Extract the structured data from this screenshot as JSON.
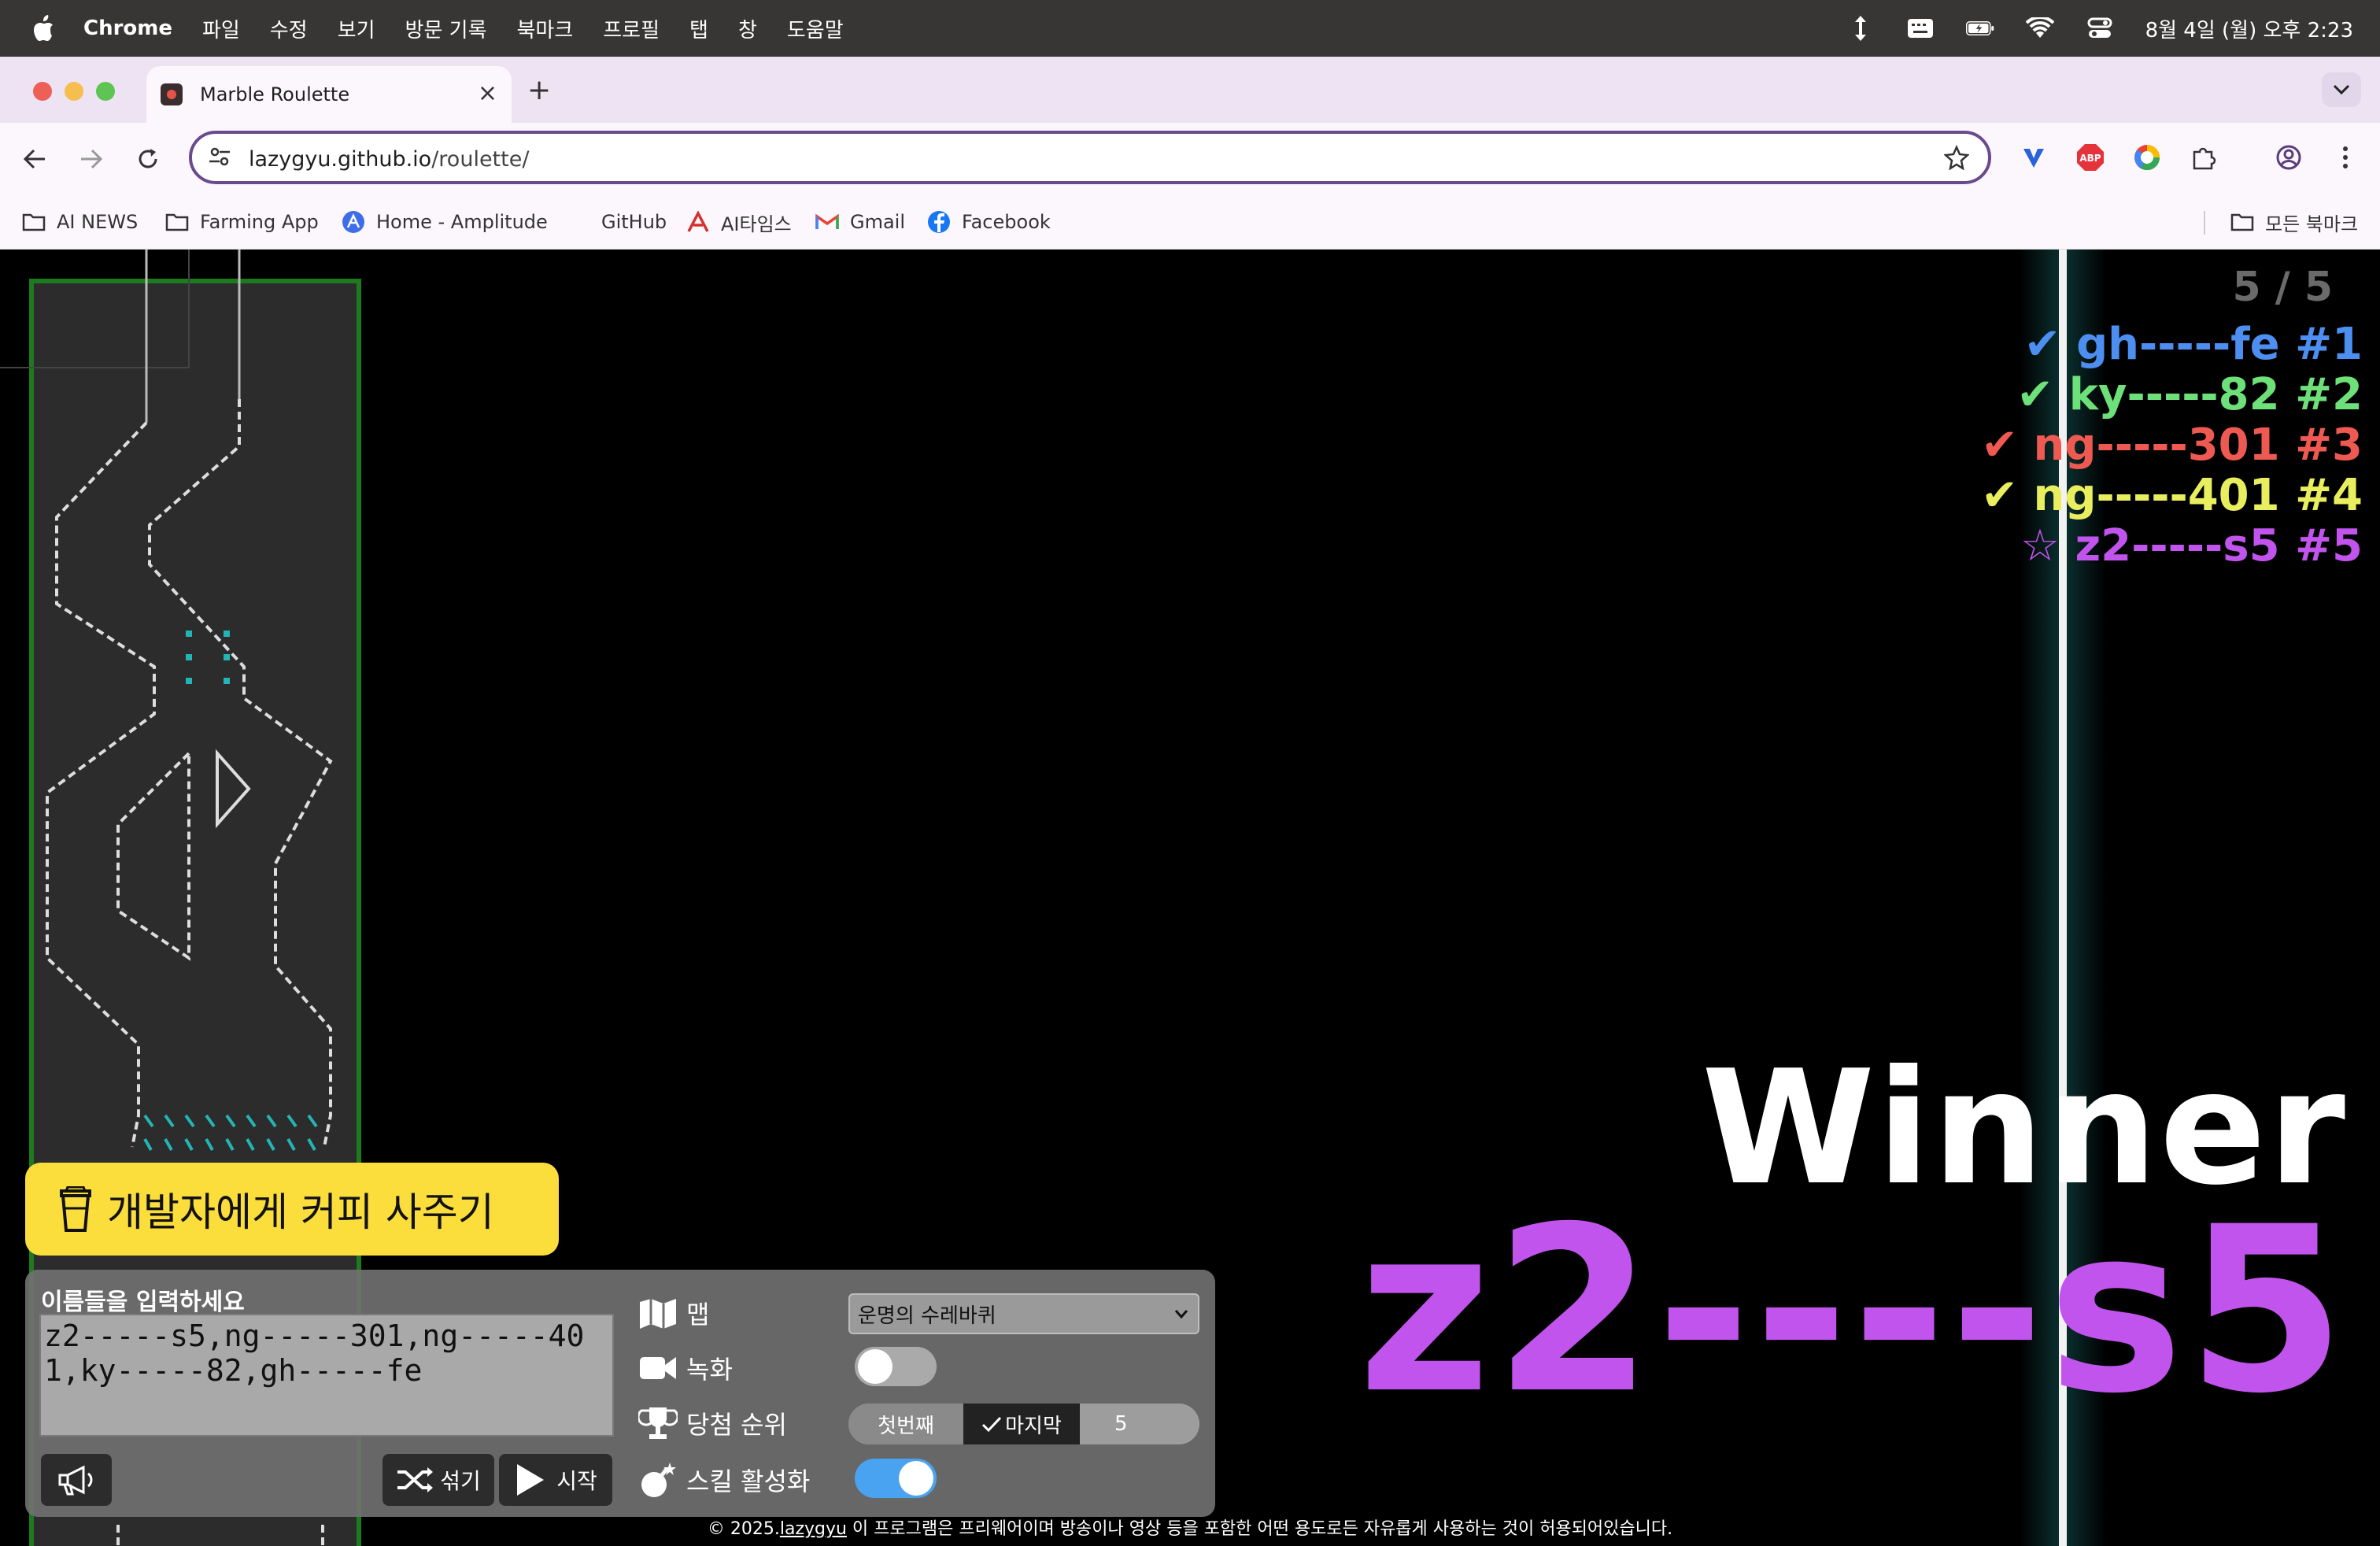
{
  "menubar": {
    "app": "Chrome",
    "items": [
      "파일",
      "수정",
      "보기",
      "방문 기록",
      "북마크",
      "프로필",
      "탭",
      "창",
      "도움말"
    ],
    "clock": "8월 4일 (월) 오후 2:23"
  },
  "tab": {
    "title": "Marble Roulette"
  },
  "address": {
    "host": "lazygyu.github.io",
    "path": "/roulette/"
  },
  "bookmarks": {
    "items": [
      "AI NEWS",
      "Farming App",
      "Home - Amplitude",
      "GitHub",
      "AI타임스",
      "Gmail",
      "Facebook"
    ],
    "all": "모든 북마크"
  },
  "game": {
    "progress": "5 / 5",
    "ranking": [
      {
        "mark": "✔",
        "name": "gh-----fe",
        "rank": "#1",
        "color": "#4d8ff0"
      },
      {
        "mark": "✔",
        "name": "ky-----82",
        "rank": "#2",
        "color": "#6ee07a"
      },
      {
        "mark": "✔",
        "name": "ng-----301",
        "rank": "#3",
        "color": "#ee5a52"
      },
      {
        "mark": "✔",
        "name": "ng-----401",
        "rank": "#4",
        "color": "#e8ee5e"
      },
      {
        "mark": "☆",
        "name": "z2-----s5",
        "rank": "#5",
        "color": "#c154ec"
      }
    ],
    "winner_label": "Winner",
    "winner_name": "z2----s5"
  },
  "coffee": {
    "label": "개발자에게 커피 사주기"
  },
  "panel": {
    "names_label": "이름들을 입력하세요",
    "names_value": "z2-----s5,ng-----301,ng-----401,ky-----82,gh-----fe",
    "shuffle": "섞기",
    "start": "시작",
    "map_label": "맵",
    "map_value": "운명의 수레바퀴",
    "record_label": "녹화",
    "record_on": false,
    "rank_label": "당첨 순위",
    "rank_first": "첫번째",
    "rank_last": "마지막",
    "rank_number": "5",
    "skill_label": "스킬 활성화",
    "skill_on": true
  },
  "footer": {
    "prefix": "© 2025.",
    "author": "lazygyu",
    "text": " 이 프로그램은 프리웨어이며 방송이나 영상 등을 포함한 어떤 용도로든 자유롭게 사용하는 것이 허용되어있습니다."
  },
  "colors": {
    "accent": "#6a4a8e",
    "coffee": "#fbdd3c",
    "winner": "#c154ec",
    "toggle_on": "#4aa3f0"
  }
}
